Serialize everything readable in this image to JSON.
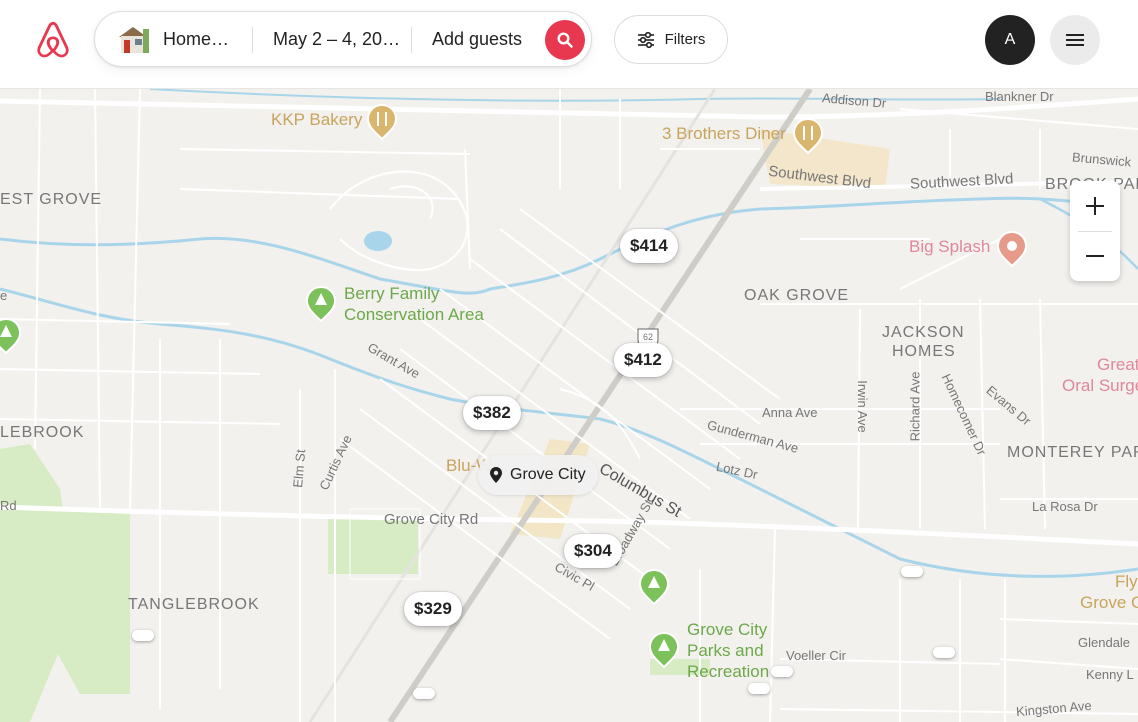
{
  "header": {
    "search": {
      "location": "Home…",
      "dates": "May 2 – 4, 20…",
      "guests": "Add guests"
    },
    "filters_label": "Filters",
    "avatar_initial": "A"
  },
  "map": {
    "area_labels": [
      "EST GROVE",
      "LEBROOK",
      "TANGLEBROOK",
      "OAK GROVE",
      "JACKSON",
      "HOMES",
      "MONTEREY PAR",
      "BROOK PAR"
    ],
    "streets": [
      "Southwest Blvd",
      "Southwest Blvd",
      "Addison Dr",
      "Blankner Dr",
      "Brunswick",
      "Grant Ave",
      "Curtis Ave",
      "Elm St",
      "Grove City Rd",
      "Anna Ave",
      "Gunderman Ave",
      "Lotz Dr",
      "Irwin Ave",
      "Richard Ave",
      "Homecomer Dr",
      "Evans Dr",
      "La Rosa Dr",
      "Civic Pl",
      "Voeller Cir",
      "Glendale",
      "Kenny L",
      "Kingston Ave",
      "Columbus St",
      "Broadway St",
      "62",
      "Rd"
    ],
    "pois": {
      "kkp": "KKP Bakery",
      "brothers": "3 Brothers Diner",
      "splash": "Big Splash",
      "berry1": "Berry Family",
      "berry2": "Conservation Area",
      "parks1": "Grove City",
      "parks2": "Parks and",
      "parks3": "Recreation",
      "oral1": "Great",
      "oral2": "Oral Surge",
      "fly1": "Fly",
      "fly2": "Grove C",
      "bluw": "Blu-W",
      "e": "e"
    },
    "prices": [
      "$414",
      "$412",
      "$382",
      "$304",
      "$329"
    ],
    "place_label": "Grove City"
  },
  "colors": {
    "brand": "#e8384f",
    "water": "#a9d5ea",
    "park": "#d7ecc4",
    "map_bg": "#f2f1ee"
  },
  "icons": [
    "airbnb-logo-icon",
    "house-thumbnail-icon",
    "search-icon",
    "filters-sliders-icon",
    "hamburger-menu-icon",
    "plus-icon",
    "minus-icon",
    "location-pin-icon",
    "food-pin-icon",
    "park-pin-icon",
    "attraction-pin-icon"
  ]
}
